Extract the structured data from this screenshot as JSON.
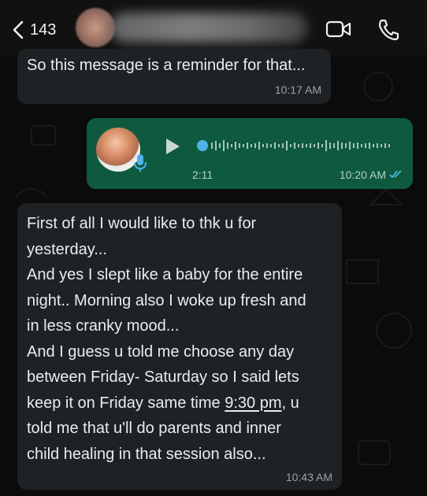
{
  "header": {
    "back_count": "143"
  },
  "messages": [
    {
      "type": "text",
      "direction": "incoming",
      "text": "So this message is a reminder for that...",
      "time": "10:17 AM"
    },
    {
      "type": "voice",
      "direction": "outgoing",
      "duration": "2:11",
      "time": "10:20 AM",
      "read_status": "read"
    },
    {
      "type": "text",
      "direction": "incoming",
      "lines": [
        "First of all I would like to thk u for",
        "yesterday...",
        "And yes I slept like a baby for the entire",
        "night.. Morning also I woke up fresh and",
        "in less cranky mood...",
        "And I guess u told me choose any day",
        "between Friday- Saturday so I said lets",
        "keep it on Friday same time ",
        "9:30 pm",
        ", u",
        "told me that u'll do parents and inner",
        "child healing in that session also..."
      ],
      "time": "10:43 AM"
    }
  ],
  "colors": {
    "incoming_bubble": "#1f2224",
    "outgoing_bubble": "#0f5a3f",
    "read_ticks": "#53bdeb"
  }
}
